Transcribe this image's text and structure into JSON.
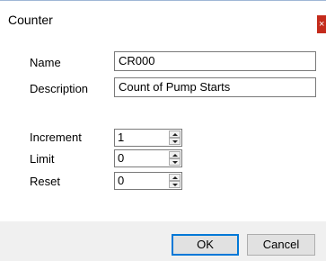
{
  "window": {
    "title": "Counter",
    "close_glyph": "×"
  },
  "fields": {
    "name_label": "Name",
    "name_value": "CR000",
    "description_label": "Description",
    "description_value": "Count of Pump Starts"
  },
  "spinners": {
    "increment_label": "Increment",
    "increment_value": "1",
    "limit_label": "Limit",
    "limit_value": "0",
    "reset_label": "Reset",
    "reset_value": "0"
  },
  "buttons": {
    "ok_label": "OK",
    "cancel_label": "Cancel"
  },
  "colors": {
    "close_button": "#c42b1c",
    "default_button_border": "#0078d7",
    "footer_bg": "#f0f0f0"
  }
}
